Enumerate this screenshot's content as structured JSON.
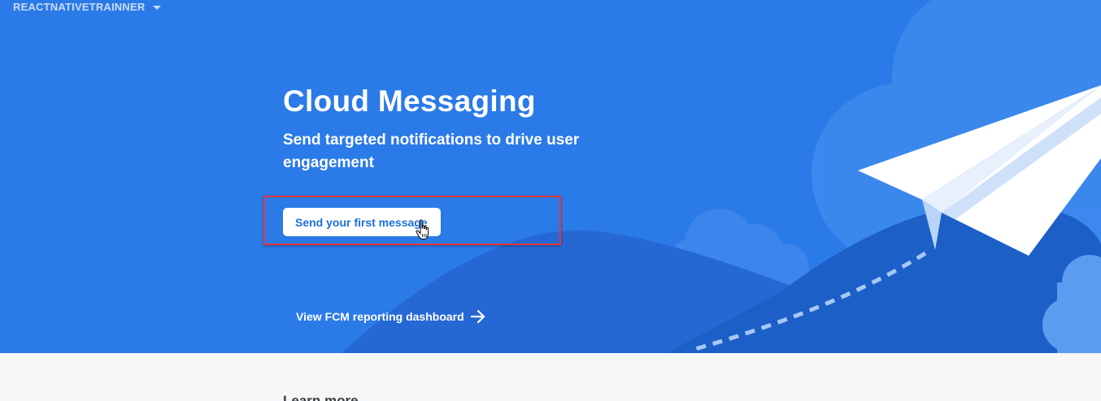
{
  "header": {
    "project_name": "REACTNATIVETRAINNER"
  },
  "hero": {
    "title": "Cloud Messaging",
    "subtitle": "Send targeted notifications to drive user engagement",
    "primary_button_label": "Send your first message",
    "report_link_label": "View FCM reporting dashboard"
  },
  "learn_more": {
    "heading": "Learn more"
  },
  "colors": {
    "hero_background": "#2a7ae8",
    "button_text": "#1a6fdc",
    "highlight_border": "#e0393e",
    "page_background": "#f5f6f8"
  },
  "icons": {
    "project_caret": "caret-down-icon",
    "report_arrow": "arrow-right-icon",
    "pointer": "hand-pointer-icon",
    "illustration": "paper-plane-icon"
  }
}
